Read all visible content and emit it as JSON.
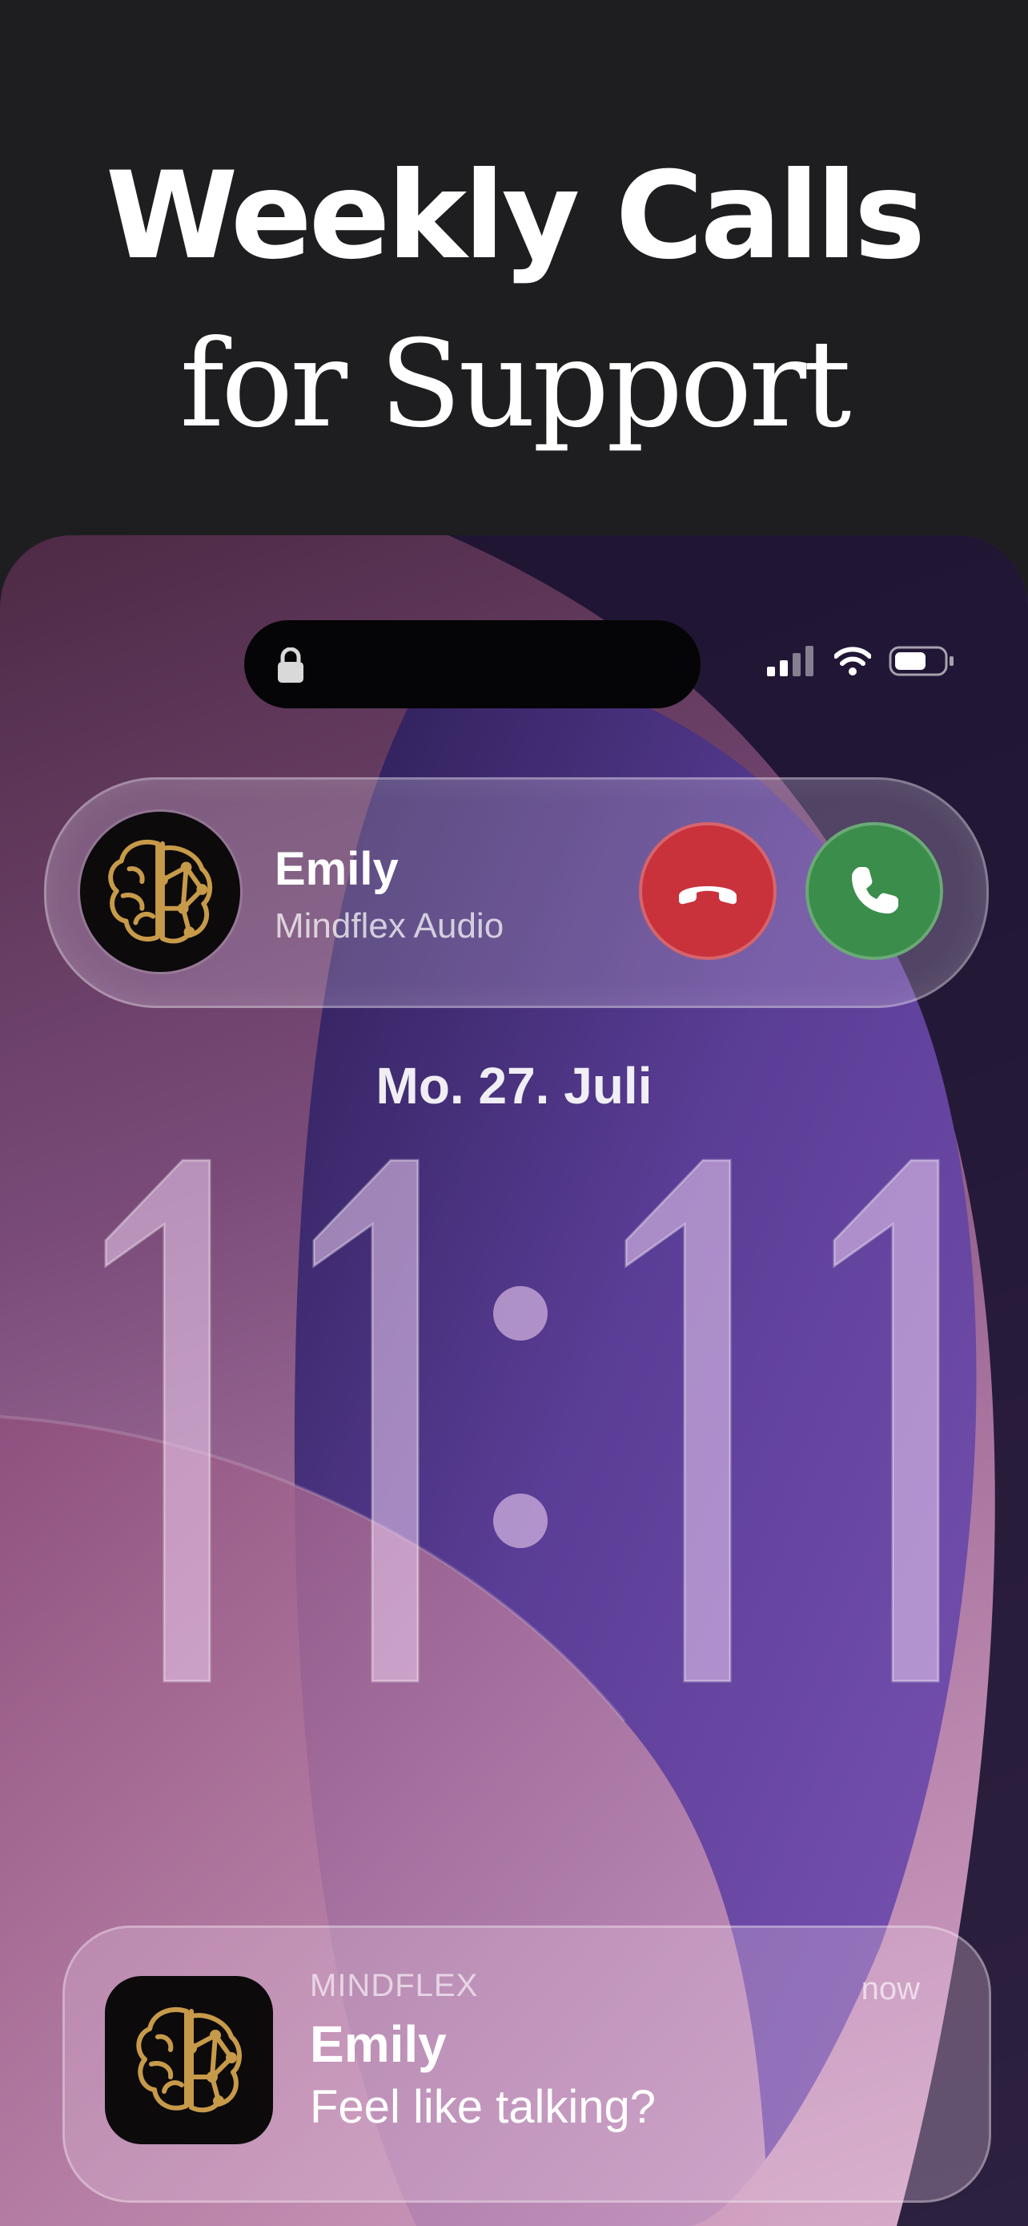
{
  "headline": {
    "line1": "Weekly Calls",
    "line2": "for Support"
  },
  "lock_screen": {
    "date": "Mo. 27. Juli",
    "time": {
      "hour": "11",
      "minute": "11",
      "separator": ":"
    },
    "status_icons": [
      "signal-icon",
      "wifi-icon",
      "battery-icon"
    ],
    "island_icon": "lock-icon"
  },
  "incoming_call": {
    "caller_name": "Emily",
    "caller_subtitle": "Mindflex Audio",
    "avatar_icon": "brain-logo-icon",
    "decline_icon": "phone-hangup-icon",
    "accept_icon": "phone-icon",
    "colors": {
      "decline": "#c9313b",
      "accept": "#3a8d4a"
    }
  },
  "notification": {
    "app_name": "MINDFLEX",
    "time": "now",
    "title": "Emily",
    "body": "Feel like talking?",
    "icon": "brain-logo-icon"
  },
  "colors": {
    "page_bg": "#1e1e20",
    "brand_gold": "#c79a4a"
  }
}
